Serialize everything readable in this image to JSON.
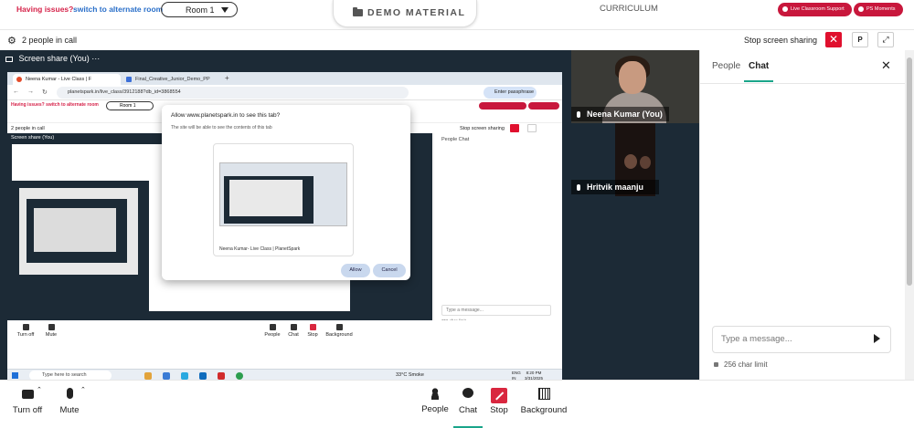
{
  "top": {
    "issues_label": "Having issues?",
    "switch_link": "switch to alternate room",
    "room_selected": "Room 1",
    "demo_material": "DEMO MATERIAL",
    "curriculum": "CURRICULUM",
    "live_support": "Live Classroom Support",
    "ps_moments": "PS Moments"
  },
  "callbar": {
    "people_count": "2 people in call",
    "stop_screen_sharing": "Stop screen sharing",
    "p_label": "P"
  },
  "stage": {
    "label": "Screen share (You) ···"
  },
  "shared_window": {
    "tab1": "Neena Kumar - Live Class | F",
    "tab2": "Final_Creative_Junior_Demo_PP",
    "url": "planetspark.in/live_class/3912188?db_id=3868554",
    "passphrase": "Enter passphrase",
    "inner_issues": "Having issues? switch to alternate room",
    "inner_room": "Room 1",
    "inner_people": "2 people in call",
    "inner_stop": "Stop screen sharing",
    "inner_stage_label": "Screen share (You)",
    "inner_chat_tabs": "People   Chat",
    "inner_msg": "Type a message...",
    "inner_limit": "256 char limit",
    "inner_controls": [
      "Turn off",
      "Mute",
      "People",
      "Chat",
      "Stop",
      "Background"
    ],
    "taskbar_search": "Type here to search",
    "weather": "33°C  Smoke",
    "lang": "ENG\nIN",
    "clock": "8:20 PM\n3/31/2025",
    "dialog_title": "Allow www.planetspark.in to see this tab?",
    "dialog_sub": "The site will be able to see the contents of this tab",
    "dialog_caption": "Neena Kumar- Live Class | PlanetSpark",
    "allow": "Allow",
    "cancel": "Cancel"
  },
  "videos": {
    "tile1_name": "Neena Kumar (You)",
    "tile2_name": "Hritvik maanju"
  },
  "chat": {
    "tab_people": "People",
    "tab_chat": "Chat",
    "placeholder": "Type a message...",
    "char_limit": "256 char limit"
  },
  "controls": {
    "turn_off": "Turn off",
    "mute": "Mute",
    "people": "People",
    "chat": "Chat",
    "stop": "Stop",
    "background": "Background"
  },
  "colors": {
    "accent": "#1aa58a",
    "danger": "#e0102e",
    "brand": "#c8173c",
    "stage_bg": "#1c2a36"
  }
}
